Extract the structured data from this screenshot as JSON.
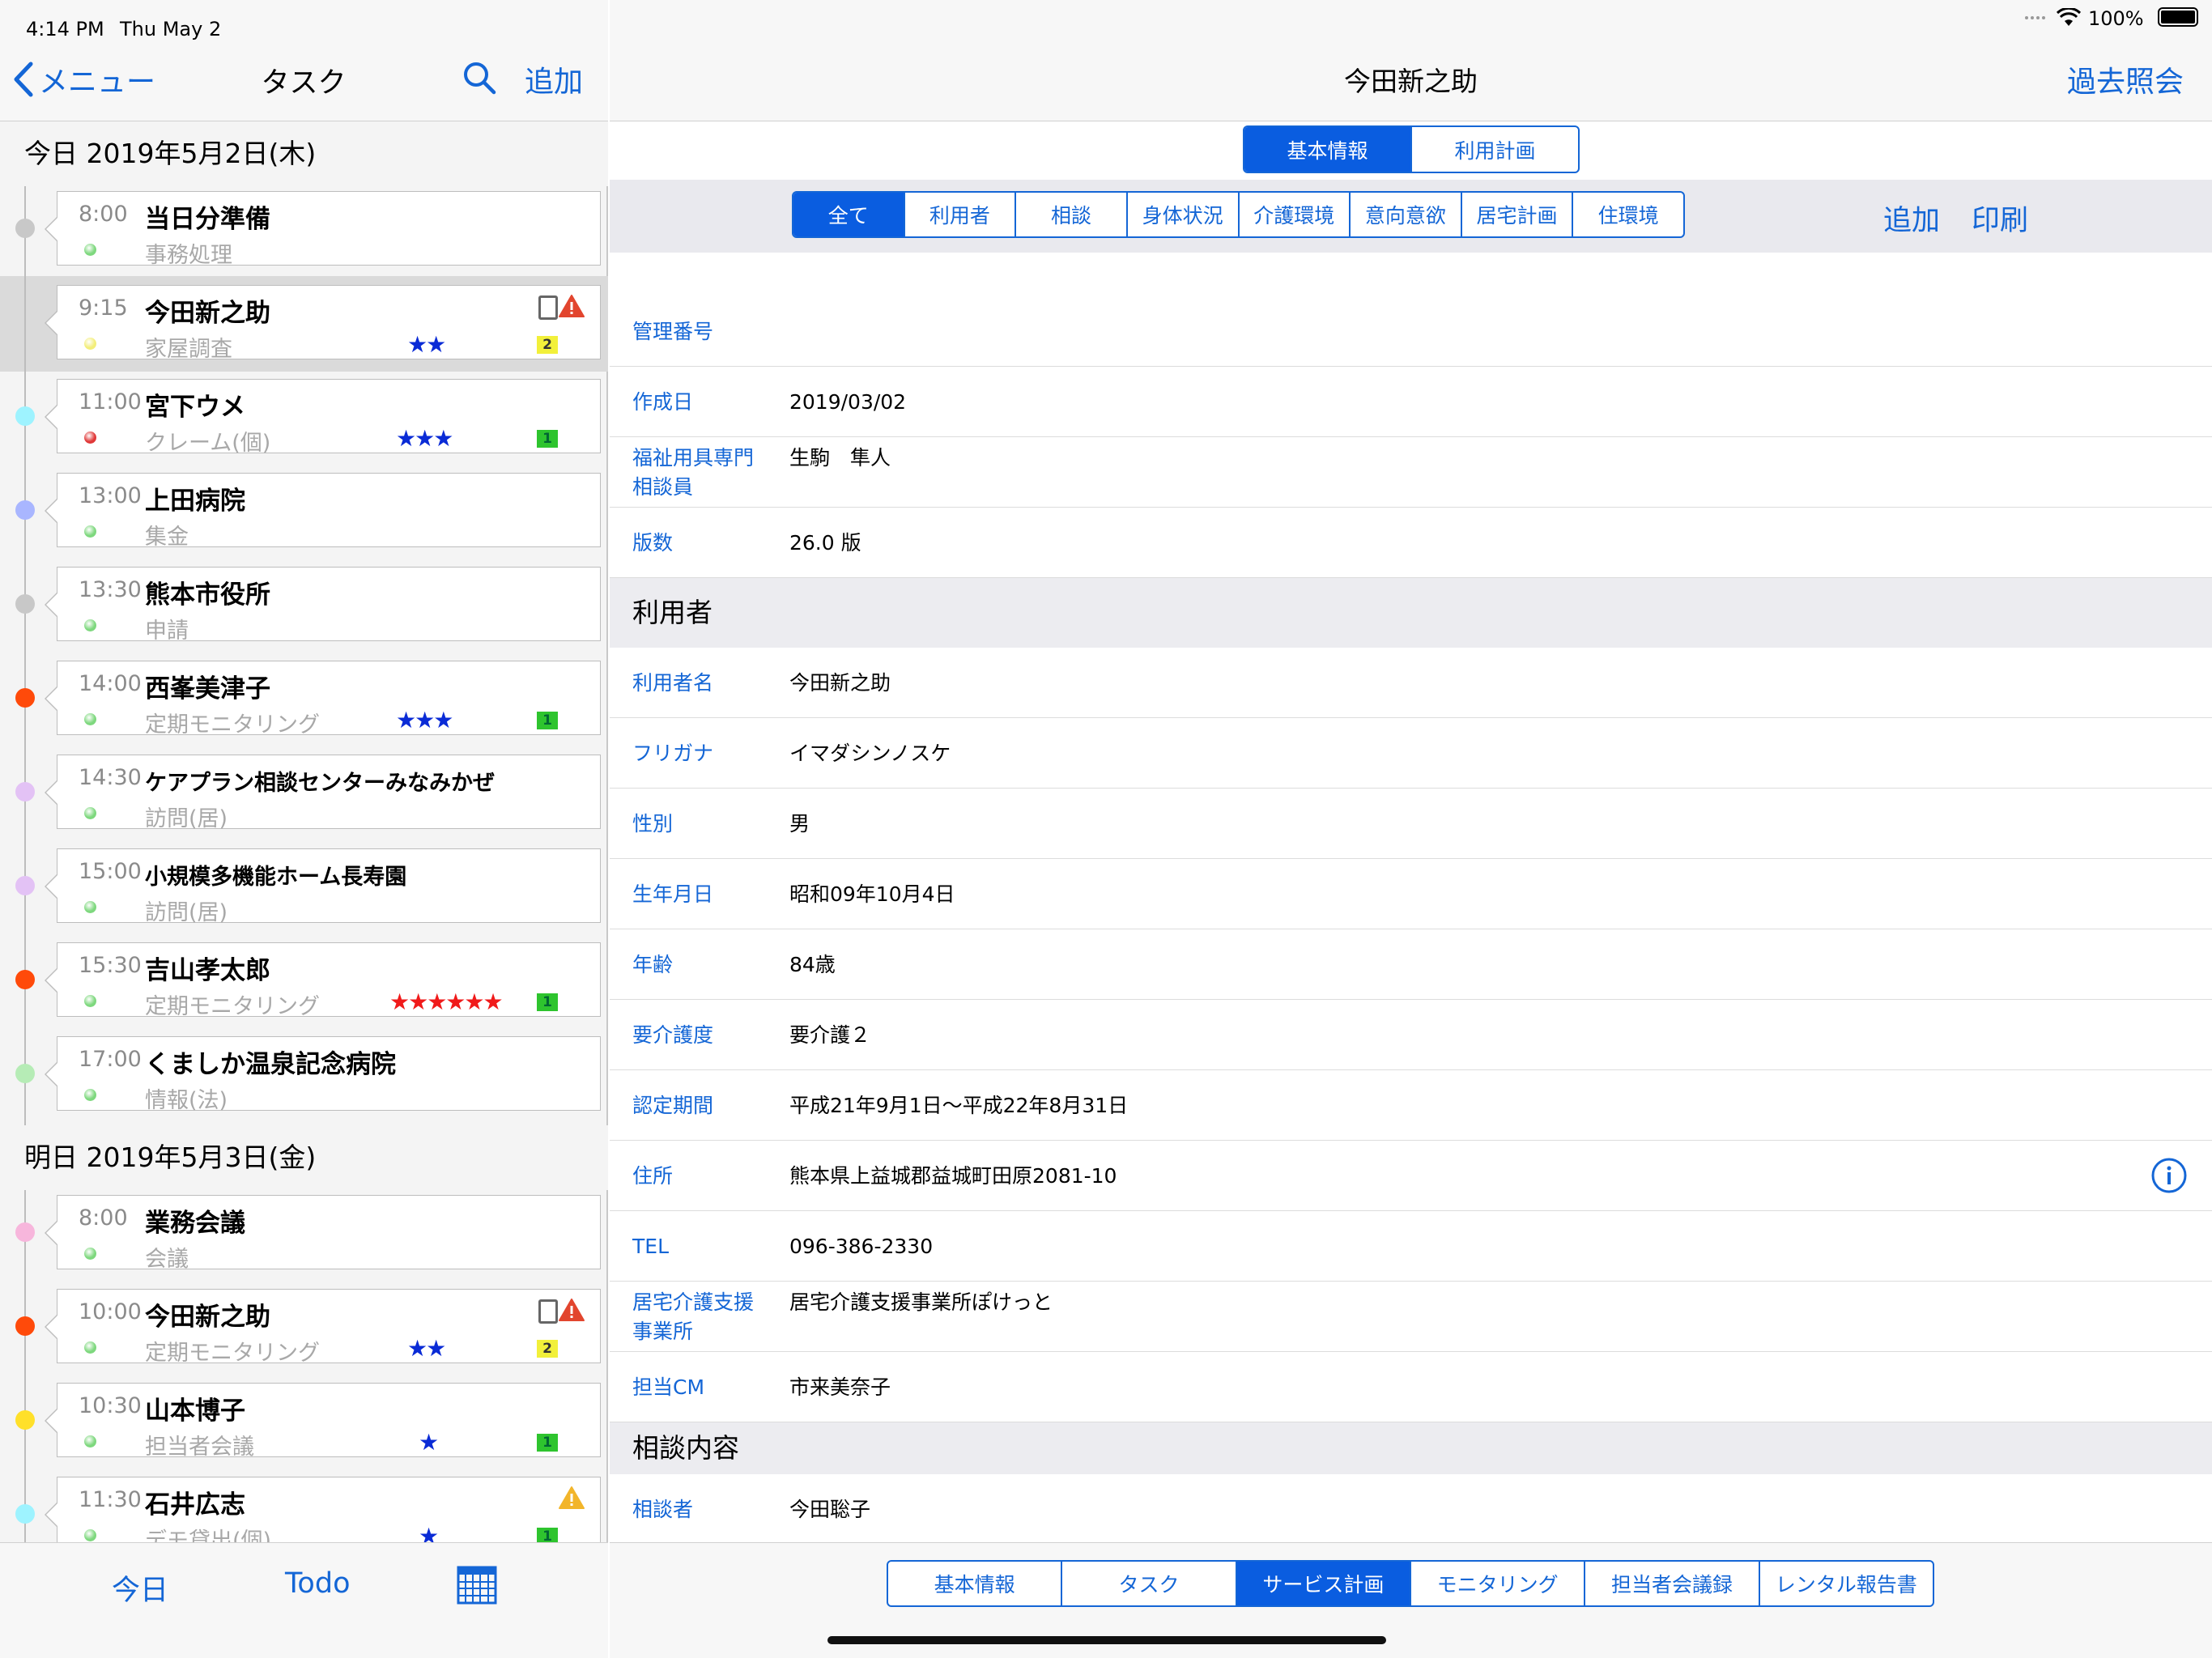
{
  "status": {
    "time": "4:14 PM",
    "date": "Thu May 2",
    "battery": "100%"
  },
  "left": {
    "back_label": "メニュー",
    "title": "タスク",
    "add_label": "追加",
    "days": [
      {
        "header": "今日 2019年5月2日(木)",
        "tasks": [
          {
            "time": "8:00",
            "name": "当日分準備",
            "category": "事務処理",
            "dot": "#c8c8c8",
            "status": "#7ed87e",
            "stars": "",
            "star_color": "#0a2bd6",
            "badge": "",
            "badge_color": "",
            "tablet": false,
            "warn": "",
            "selected": false
          },
          {
            "time": "9:15",
            "name": "今田新之助",
            "category": "家屋調査",
            "dot": "",
            "status": "#f3ee7a",
            "stars": "★★",
            "star_color": "#0a2bd6",
            "badge": "2",
            "badge_color": "#f2f03a",
            "tablet": true,
            "warn": "red",
            "selected": true
          },
          {
            "time": "11:00",
            "name": "宮下ウメ",
            "category": "クレーム(個)",
            "dot": "#9ef3ff",
            "status": "#e03838",
            "stars": "★★★",
            "star_color": "#0a2bd6",
            "badge": "1",
            "badge_color": "#2ec42e",
            "tablet": false,
            "warn": "",
            "selected": false
          },
          {
            "time": "13:00",
            "name": "上田病院",
            "category": "集金",
            "dot": "#a9b6ff",
            "status": "#7ed87e",
            "stars": "",
            "star_color": "#0a2bd6",
            "badge": "",
            "badge_color": "",
            "tablet": false,
            "warn": "",
            "selected": false
          },
          {
            "time": "13:30",
            "name": "熊本市役所",
            "category": "申請",
            "dot": "#c8c8c8",
            "status": "#7ed87e",
            "stars": "",
            "star_color": "#0a2bd6",
            "badge": "",
            "badge_color": "",
            "tablet": false,
            "warn": "",
            "selected": false
          },
          {
            "time": "14:00",
            "name": "西峯美津子",
            "category": "定期モニタリング",
            "dot": "#ff4a0a",
            "status": "#7ed87e",
            "stars": "★★★",
            "star_color": "#0a2bd6",
            "badge": "1",
            "badge_color": "#2ec42e",
            "tablet": false,
            "warn": "",
            "selected": false
          },
          {
            "time": "14:30",
            "name": "ケアプラン相談センターみなみかぜ",
            "category": "訪問(居)",
            "dot": "#e3c2f5",
            "status": "#7ed87e",
            "stars": "",
            "star_color": "#0a2bd6",
            "badge": "",
            "badge_color": "",
            "tablet": false,
            "warn": "",
            "selected": false
          },
          {
            "time": "15:00",
            "name": "小規模多機能ホーム長寿園",
            "category": "訪問(居)",
            "dot": "#e3c2f5",
            "status": "#7ed87e",
            "stars": "",
            "star_color": "#0a2bd6",
            "badge": "",
            "badge_color": "",
            "tablet": false,
            "warn": "",
            "selected": false
          },
          {
            "time": "15:30",
            "name": "吉山孝太郎",
            "category": "定期モニタリング",
            "dot": "#ff4a0a",
            "status": "#7ed87e",
            "stars": "★★★★★★",
            "star_color": "#f01a1a",
            "badge": "1",
            "badge_color": "#2ec42e",
            "tablet": false,
            "warn": "",
            "selected": false
          },
          {
            "time": "17:00",
            "name": "くましか温泉記念病院",
            "category": "情報(法)",
            "dot": "#b6ecb6",
            "status": "#7ed87e",
            "stars": "",
            "star_color": "#0a2bd6",
            "badge": "",
            "badge_color": "",
            "tablet": false,
            "warn": "",
            "selected": false
          }
        ]
      },
      {
        "header": "明日 2019年5月3日(金)",
        "tasks": [
          {
            "time": "8:00",
            "name": "業務会議",
            "category": "会議",
            "dot": "#f7b6dc",
            "status": "#7ed87e",
            "stars": "",
            "star_color": "#0a2bd6",
            "badge": "",
            "badge_color": "",
            "tablet": false,
            "warn": "",
            "selected": false
          },
          {
            "time": "10:00",
            "name": "今田新之助",
            "category": "定期モニタリング",
            "dot": "#ff4a0a",
            "status": "#7ed87e",
            "stars": "★★",
            "star_color": "#0a2bd6",
            "badge": "2",
            "badge_color": "#f2f03a",
            "tablet": true,
            "warn": "red",
            "selected": false
          },
          {
            "time": "10:30",
            "name": "山本博子",
            "category": "担当者会議",
            "dot": "#ffe02a",
            "status": "#7ed87e",
            "stars": "★",
            "star_color": "#0a2bd6",
            "badge": "1",
            "badge_color": "#2ec42e",
            "tablet": false,
            "warn": "",
            "selected": false
          },
          {
            "time": "11:30",
            "name": "石井広志",
            "category": "デモ貸出(個)",
            "dot": "#9ef3ff",
            "status": "#7ed87e",
            "stars": "★",
            "star_color": "#0a2bd6",
            "badge": "1",
            "badge_color": "#2ec42e",
            "tablet": false,
            "warn": "yellow",
            "selected": false
          }
        ]
      }
    ],
    "tabs": {
      "today": "今日",
      "todo": "Todo"
    }
  },
  "right": {
    "title": "今田新之助",
    "history_label": "過去照会",
    "top_segments": [
      {
        "label": "基本情報",
        "on": true
      },
      {
        "label": "利用計画",
        "on": false
      }
    ],
    "filters": [
      {
        "label": "全て",
        "on": true
      },
      {
        "label": "利用者",
        "on": false
      },
      {
        "label": "相談",
        "on": false
      },
      {
        "label": "身体状況",
        "on": false
      },
      {
        "label": "介護環境",
        "on": false
      },
      {
        "label": "意向意欲",
        "on": false
      },
      {
        "label": "居宅計画",
        "on": false
      },
      {
        "label": "住環境",
        "on": false
      }
    ],
    "add_label": "追加",
    "print_label": "印刷",
    "header_rows": [
      {
        "label": "管理番号",
        "value": ""
      },
      {
        "label": "作成日",
        "value": "2019/03/02"
      },
      {
        "label": "福祉用具専門\n相談員",
        "value": "生駒　隼人"
      },
      {
        "label": "版数",
        "value": "26.0 版"
      }
    ],
    "section_user": "利用者",
    "user_rows": [
      {
        "label": "利用者名",
        "value": "今田新之助"
      },
      {
        "label": "フリガナ",
        "value": "イマダシンノスケ"
      },
      {
        "label": "性別",
        "value": "男"
      },
      {
        "label": "生年月日",
        "value": "昭和09年10月4日"
      },
      {
        "label": "年齢",
        "value": "84歳"
      },
      {
        "label": "要介護度",
        "value": "要介護２"
      },
      {
        "label": "認定期間",
        "value": "平成21年9月1日～平成22年8月31日"
      },
      {
        "label": "住所",
        "value": "熊本県上益城郡益城町田原2081-10"
      },
      {
        "label": "TEL",
        "value": "096-386-2330"
      },
      {
        "label": "居宅介護支援\n事業所",
        "value": "居宅介護支援事業所ぽけっと"
      },
      {
        "label": "担当CM",
        "value": "市来美奈子"
      }
    ],
    "section_consult": "相談内容",
    "consult_rows": [
      {
        "label": "相談者",
        "value": "今田聡子"
      }
    ],
    "bottom_tabs": [
      {
        "label": "基本情報",
        "on": false
      },
      {
        "label": "タスク",
        "on": false
      },
      {
        "label": "サービス計画",
        "on": true
      },
      {
        "label": "モニタリング",
        "on": false
      },
      {
        "label": "担当者会議録",
        "on": false
      },
      {
        "label": "レンタル報告書",
        "on": false
      }
    ]
  },
  "icons": [
    "back-chevron-icon",
    "search-icon",
    "calendar-icon",
    "info-icon",
    "wifi-icon",
    "battery-icon",
    "tablet-icon",
    "warning-icon"
  ]
}
